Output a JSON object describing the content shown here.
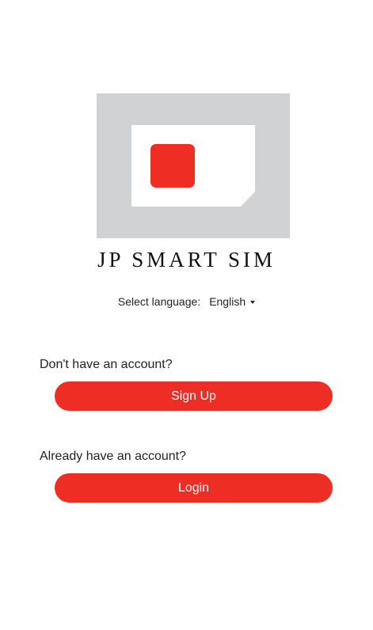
{
  "brand": {
    "name": "JP SMART SIM",
    "colors": {
      "accent": "#ee2e24",
      "logo_frame": "#d1d2d4"
    }
  },
  "language": {
    "label": "Select language:",
    "selected": "English",
    "icon": "caret-down-icon"
  },
  "signup": {
    "prompt": "Don't have an account?",
    "button_label": "Sign Up"
  },
  "login": {
    "prompt": "Already have an account?",
    "button_label": "Login"
  }
}
